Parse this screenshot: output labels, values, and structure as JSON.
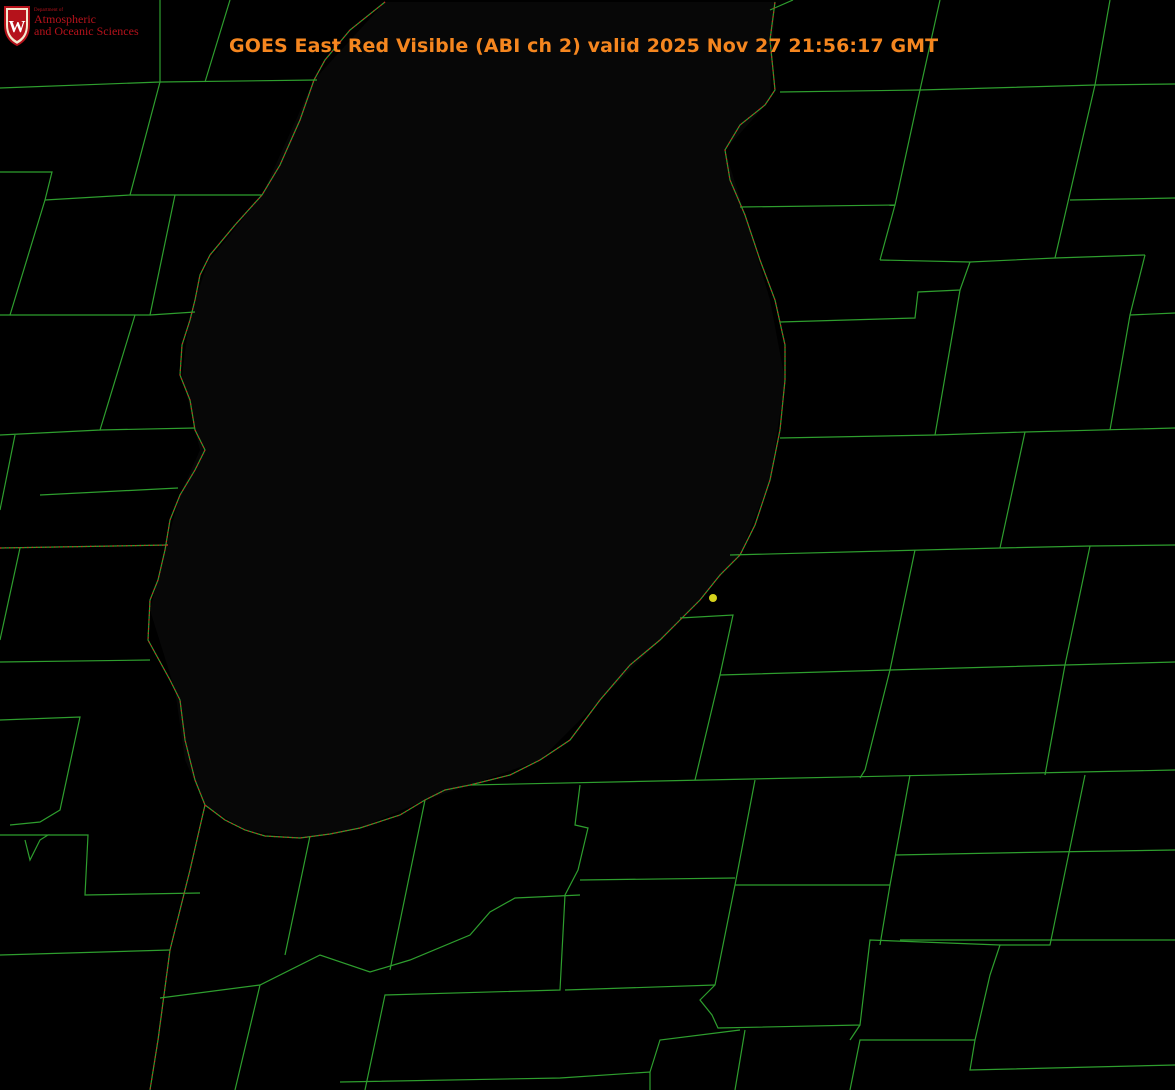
{
  "header": {
    "title": "GOES East Red Visible (ABI ch 2) valid 2025 Nov 27 21:56:17 GMT"
  },
  "logo": {
    "crest_letter": "W",
    "department": "Department of",
    "line1": "Atmospheric",
    "line2": "and Oceanic Sciences",
    "color": "#b5121b"
  },
  "map": {
    "background_color": "#000000",
    "boundary_color": "#2e9e2e",
    "coastline_color": "#d42020",
    "marker_color": "#d6d21c",
    "marker_icon": "location-dot-icon"
  }
}
